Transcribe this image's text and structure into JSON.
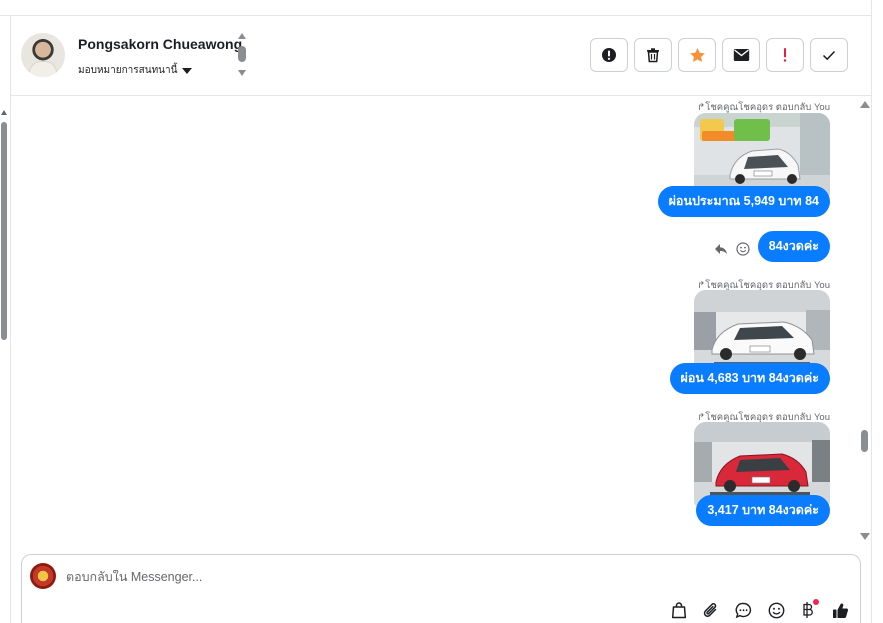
{
  "contact": {
    "name": "Pongsakorn Chueawong",
    "assign_label": "มอบหมายการสนทนานี้"
  },
  "actions": [
    {
      "name": "info-button",
      "icon": "exclamation-circle-icon"
    },
    {
      "name": "delete-button",
      "icon": "trash-icon"
    },
    {
      "name": "star-button",
      "icon": "star-icon",
      "color": "#f7923a"
    },
    {
      "name": "mark-unread-button",
      "icon": "envelope-icon"
    },
    {
      "name": "spam-button",
      "icon": "exclamation-icon",
      "color": "#e41e3f"
    },
    {
      "name": "done-button",
      "icon": "check-icon"
    }
  ],
  "messages": [
    {
      "reply_note": "↱โชคคูณโชคอุดร ตอบกลับ You",
      "photo": "white-nissan-note",
      "text": "ผ่อนประมาณ 5,949 บาท 84"
    },
    {
      "text": "84งวดค่ะ"
    },
    {
      "reply_note": "↱โชคคูณโชคอุดร ตอบกลับ You",
      "photo": "white-mazda2",
      "text": "ผ่อน 4,683 บาท 84งวดค่ะ"
    },
    {
      "reply_note": "↱โชคคูณโชคอุดร ตอบกลับ You",
      "photo": "red-mazda2",
      "text": "3,417 บาท 84งวดค่ะ"
    }
  ],
  "composer": {
    "placeholder": "ตอบกลับใน Messenger...",
    "tools": [
      "bag-icon",
      "paperclip-icon",
      "chat-bubble-icon",
      "emoji-icon",
      "baht-icon",
      "thumbs-up-icon"
    ]
  },
  "colors": {
    "accent": "#0a7cff",
    "star": "#f7923a",
    "alert": "#e41e3f"
  }
}
